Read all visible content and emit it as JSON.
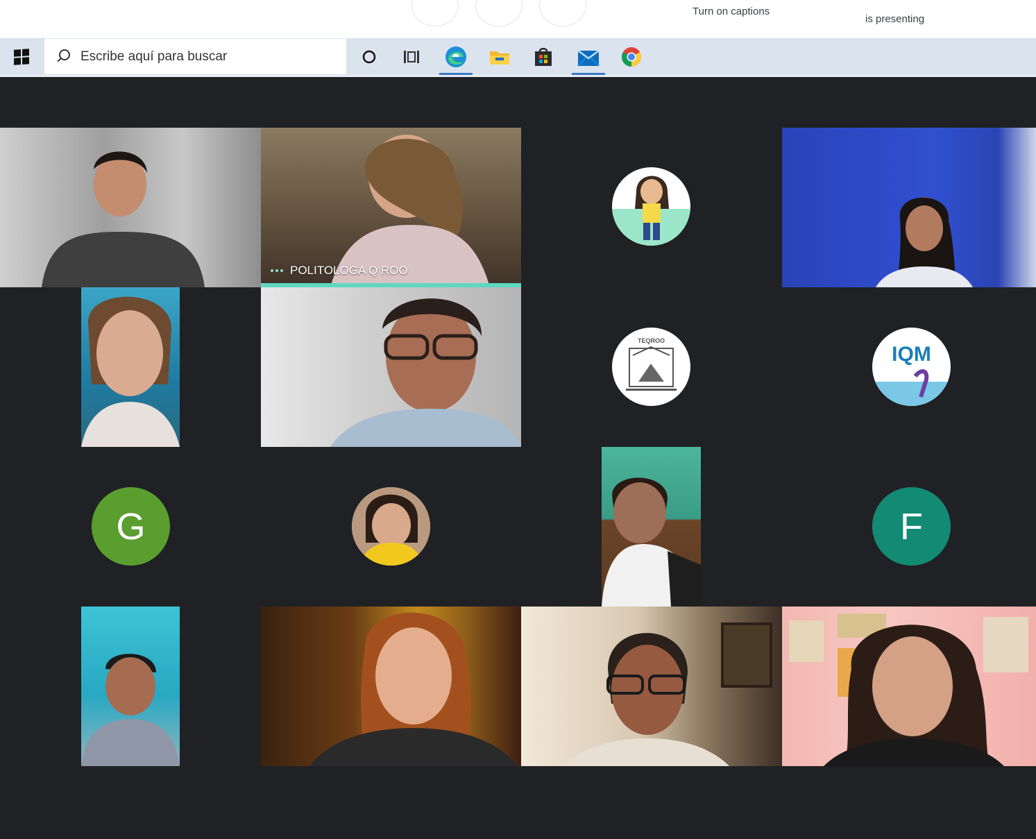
{
  "top_bar": {
    "captions_label": "Turn on captions",
    "presenting_label": "is presenting"
  },
  "taskbar": {
    "search_placeholder": "Escribe aquí para buscar",
    "icons": [
      "windows-start-icon",
      "cortana-icon",
      "task-view-icon",
      "edge-icon",
      "file-explorer-icon",
      "store-icon",
      "mail-icon",
      "chrome-icon"
    ]
  },
  "meeting": {
    "active_speaker_name": "POLITOLOGA Q ROO",
    "avatars": {
      "participant_g": "G",
      "participant_f": "F",
      "teqroo": "TEQROO",
      "iqm": "IQM"
    }
  },
  "colors": {
    "stage_bg": "#202124",
    "taskbar_bg": "#dbe3ef",
    "speaker_accent": "#5fd8c0",
    "avatar_g": "#5a9e2f",
    "avatar_f": "#138a73"
  }
}
